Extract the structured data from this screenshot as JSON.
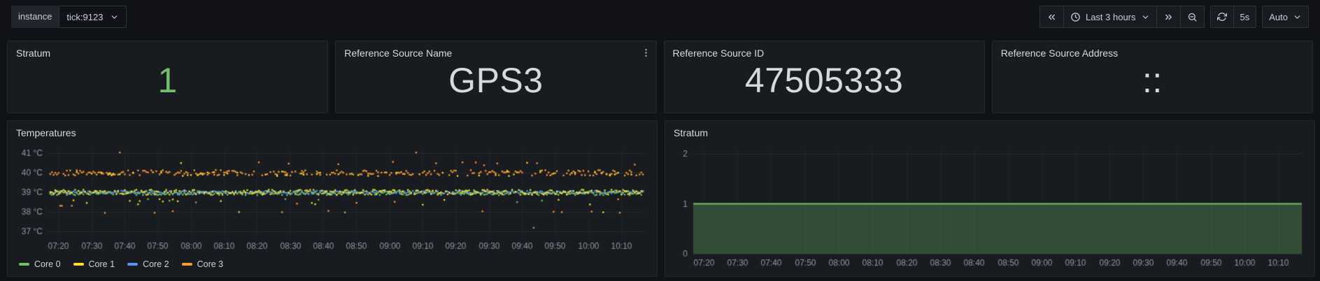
{
  "topbar": {
    "variable": {
      "label": "instance",
      "value": "tick:9123"
    },
    "time_range_label": "Last 3 hours",
    "refresh_interval": "5s",
    "auto_label": "Auto"
  },
  "icons": {
    "variable_dropdown": "chevron-down-icon",
    "time_shift_back": "chevrons-left-icon",
    "time_picker": "clock-icon",
    "time_picker_caret": "chevron-down-icon",
    "time_shift_forward": "chevrons-right-icon",
    "zoom_out": "search-minus-icon",
    "refresh": "refresh-icon",
    "auto_caret": "chevron-down-icon",
    "panel_menu": "kebab-menu-icon"
  },
  "colors": {
    "page_bg": "#111217",
    "panel_bg": "#181b1f",
    "panel_border": "#25272c",
    "accent_green": "#73bf69",
    "stat_text": "#d8d9da",
    "axis_text": "rgba(204,204,220,0.68)"
  },
  "stats": [
    {
      "title": "Stratum",
      "value": "1",
      "color": "#73bf69"
    },
    {
      "title": "Reference Source Name",
      "value": "GPS3",
      "color": "#d8d9da",
      "menu": true
    },
    {
      "title": "Reference Source ID",
      "value": "47505333",
      "color": "#d8d9da"
    },
    {
      "title": "Reference Source Address",
      "value": "::",
      "color": "#d8d9da"
    }
  ],
  "chart_data": [
    {
      "type": "scatter",
      "title": "Temperatures",
      "y_unit": "°C",
      "y_ticks": [
        37,
        38,
        39,
        40,
        41
      ],
      "ylim": [
        36.7,
        41.3
      ],
      "x_tick_labels": [
        "07:20",
        "07:30",
        "07:40",
        "07:50",
        "08:00",
        "08:10",
        "08:20",
        "08:30",
        "08:40",
        "08:50",
        "09:00",
        "09:10",
        "09:20",
        "09:30",
        "09:40",
        "09:50",
        "10:00",
        "10:10"
      ],
      "x_tick_minutes": [
        440,
        450,
        460,
        470,
        480,
        490,
        500,
        510,
        520,
        530,
        540,
        550,
        560,
        570,
        580,
        590,
        600,
        610
      ],
      "x_domain_minutes": [
        437,
        617
      ],
      "legend_position": "bottom",
      "grid": true,
      "point_step_minutes": 0.5,
      "seed": 20240210,
      "draw_order": [
        2,
        0,
        3,
        1
      ],
      "series": [
        {
          "name": "Core 0",
          "color": "#73bf69",
          "base": 38.95,
          "jitter": 0.1,
          "skip_p": 0.1,
          "outliers": [
            {
              "p": 0.006,
              "y": 37.25,
              "j": 0.15
            },
            {
              "p": 0.03,
              "y": 38.55,
              "j": 0.1
            }
          ]
        },
        {
          "name": "Core 1",
          "color": "#fade2a",
          "base": 39.0,
          "jitter": 0.13,
          "skip_p": 0.02,
          "outliers": [
            {
              "p": 0.17,
              "y": 39.95,
              "j": 0.12
            },
            {
              "p": 0.05,
              "y": 38.5,
              "j": 0.15
            },
            {
              "p": 0.02,
              "y": 38.0,
              "j": 0.08
            },
            {
              "p": 0.008,
              "y": 40.45,
              "j": 0.1
            }
          ]
        },
        {
          "name": "Core 2",
          "color": "#5794f2",
          "base": 39.0,
          "jitter": 0.08,
          "skip_p": 0.0,
          "outliers": []
        },
        {
          "name": "Core 3",
          "color": "#ff9830",
          "base": 40.0,
          "jitter": 0.14,
          "skip_p": 0.25,
          "outliers": [
            {
              "p": 0.05,
              "y": 40.5,
              "j": 0.12
            },
            {
              "p": 0.012,
              "y": 41.0,
              "j": 0.08
            },
            {
              "p": 0.06,
              "y": 38.45,
              "j": 0.2
            },
            {
              "p": 0.02,
              "y": 38.0,
              "j": 0.08
            }
          ]
        }
      ],
      "summary": "CPU core temperatures over last 3 hours, ~37-41 C; Core 3 band around 40 C, Cores 0/1/2 around 39 C with sparse excursions to 37, 38 and 41 C"
    },
    {
      "type": "area",
      "title": "Stratum",
      "y_unit": "",
      "y_ticks": [
        0,
        1,
        2
      ],
      "ylim": [
        0,
        2.1
      ],
      "x_tick_labels": [
        "07:20",
        "07:30",
        "07:40",
        "07:50",
        "08:00",
        "08:10",
        "08:20",
        "08:30",
        "08:40",
        "08:50",
        "09:00",
        "09:10",
        "09:20",
        "09:30",
        "09:40",
        "09:50",
        "10:00",
        "10:10"
      ],
      "x_tick_minutes": [
        440,
        450,
        460,
        470,
        480,
        490,
        500,
        510,
        520,
        530,
        540,
        550,
        560,
        570,
        580,
        590,
        600,
        610
      ],
      "x_domain_minutes": [
        437,
        617
      ],
      "series": [
        {
          "name": "stratum",
          "color": "#73bf69",
          "fill": "rgba(115,191,105,0.30)",
          "value": 1
        }
      ],
      "summary": "NTP stratum constant at 1 across the entire 3-hour window"
    }
  ]
}
